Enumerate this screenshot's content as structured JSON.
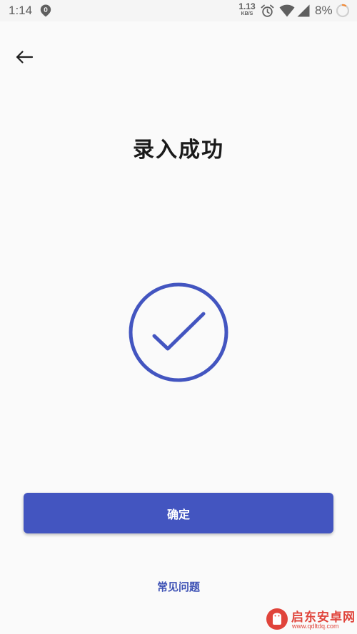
{
  "status_bar": {
    "time": "1:14",
    "net_speed_value": "1.13",
    "net_speed_unit": "KB/S",
    "battery_percent": "8%",
    "icons": [
      "notification-icon",
      "alarm-icon",
      "wifi-icon",
      "signal-icon",
      "battery-ring-icon"
    ]
  },
  "nav": {
    "back_icon": "arrow-left-icon"
  },
  "main": {
    "title": "录入成功",
    "status_icon": "check-circle-icon",
    "confirm_label": "确定",
    "faq_label": "常见问题"
  },
  "watermark": {
    "name": "启东安卓网",
    "url": "www.qdltdq.com"
  },
  "colors": {
    "accent": "#4355c0",
    "link": "#3e52b5",
    "background": "#fafafa",
    "status_bar": "#f5f5f5",
    "battery_ring": "#f08c3c",
    "watermark": "#e0443b"
  }
}
